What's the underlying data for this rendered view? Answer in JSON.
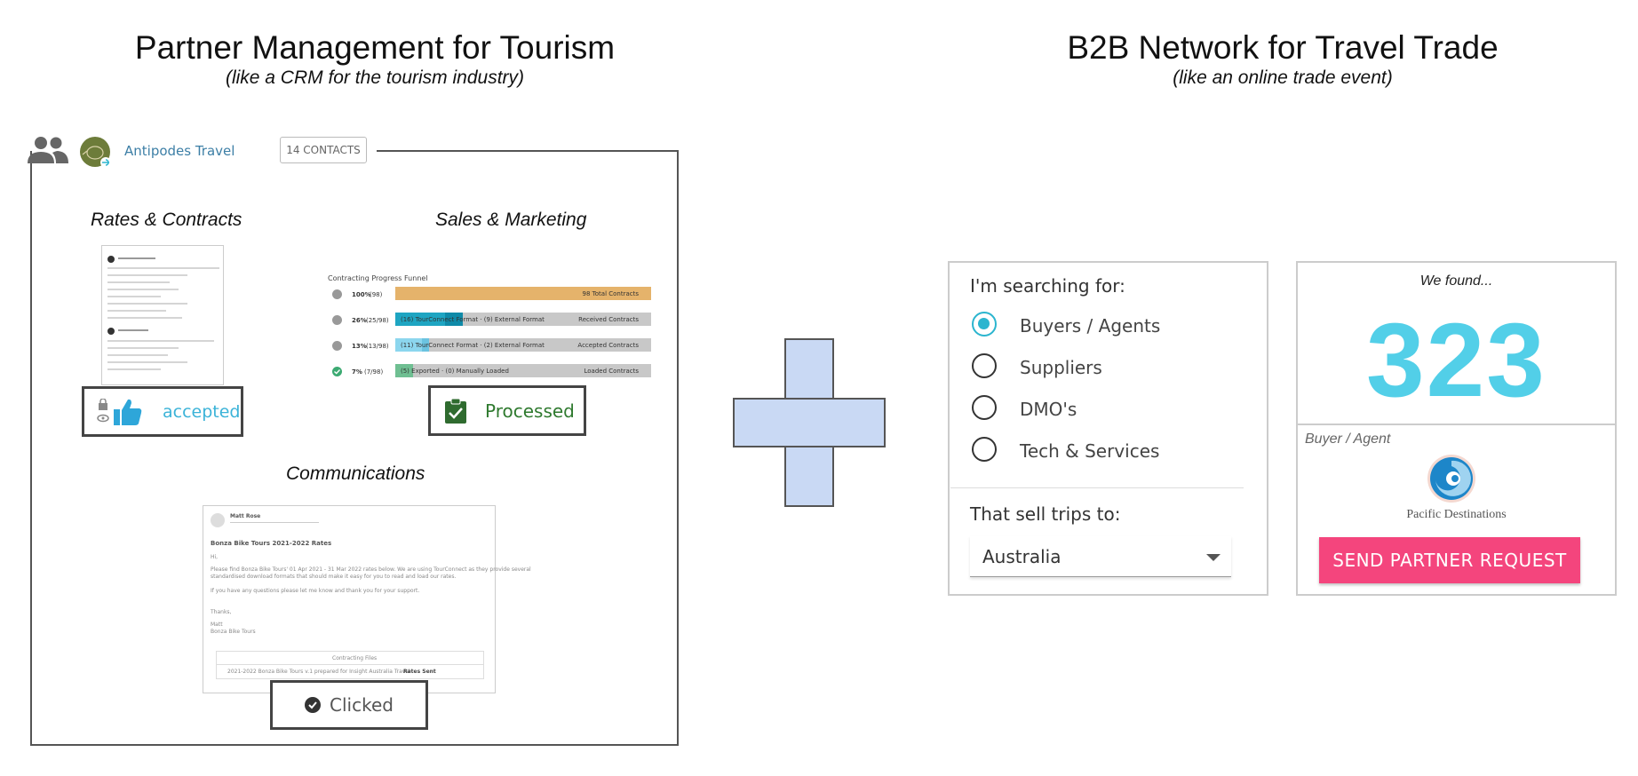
{
  "left": {
    "title": "Partner Management for Tourism",
    "subtitle": "(like a CRM for the tourism industry)",
    "company": "Antipodes Travel",
    "contacts_badge": "14 CONTACTS",
    "sections": {
      "rates": "Rates & Contracts",
      "sales": "Sales & Marketing",
      "comms": "Communications"
    },
    "statuses": {
      "accepted": "accepted",
      "processed": "Processed",
      "clicked": "Clicked"
    },
    "funnel": {
      "title": "Contracting Progress Funnel",
      "rows": [
        {
          "pct": "100%",
          "count": "(98)",
          "detail": "",
          "label": "98 Total Contracts"
        },
        {
          "pct": "26%",
          "count": "(25/98)",
          "detail": "(16) TourConnect Format · (9) External Format",
          "label": "Received Contracts"
        },
        {
          "pct": "13%",
          "count": "(13/98)",
          "detail": "(11) TourConnect Format · (2) External Format",
          "label": "Accepted Contracts"
        },
        {
          "pct": "7%",
          "count": "(7/98)",
          "detail": "(5) Exported · (0) Manually Loaded",
          "label": "Loaded Contracts"
        }
      ]
    },
    "email": {
      "sender": "Matt Rose",
      "subject": "Bonza Bike Tours 2021-2022 Rates",
      "greeting": "Hi,",
      "body1": "Please find Bonza Bike Tours' 01 Apr 2021 - 31 Mar 2022 rates below. We are using TourConnect as they provide several",
      "body2": "standardised download formats that should make it easy for you to read and load our rates.",
      "body3": "If you have any questions please let me know and thank you for your support.",
      "thanks": "Thanks,",
      "sig1": "Matt",
      "sig2": "Bonza Bike Tours",
      "files_title": "Contracting Files",
      "file_line": "2021-2022 Bonza Bike Tours v.1 prepared for Insight Australia Travel",
      "file_status": "Rates Sent"
    }
  },
  "right": {
    "title": "B2B Network for Travel Trade",
    "subtitle": "(like an online trade event)",
    "search_heading": "I'm searching for:",
    "options": [
      "Buyers / Agents",
      "Suppliers",
      "DMO's",
      "Tech & Services"
    ],
    "selected_option": "Buyers / Agents",
    "sell_heading": "That sell trips to:",
    "destination": "Australia",
    "found_label": "We found...",
    "found_count": "323",
    "buyer_type": "Buyer / Agent",
    "partner_logo": "Pacific Destinations",
    "cta": "SEND PARTNER REQUEST",
    "accent_color": "#52cfe8",
    "cta_color": "#f4457d"
  }
}
